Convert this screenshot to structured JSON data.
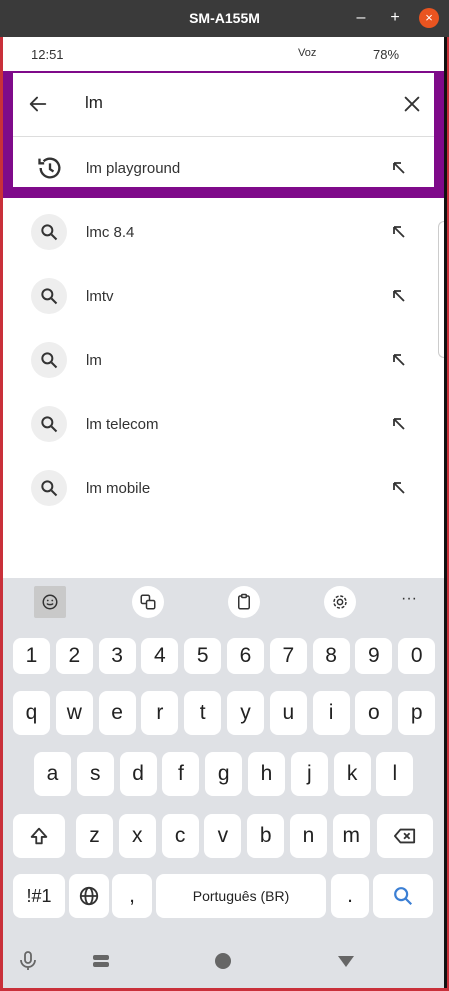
{
  "window": {
    "title": "SM-A155M",
    "minimize": "–",
    "maximize": "+",
    "close": "×"
  },
  "status": {
    "time": "12:51",
    "icons": "Voz",
    "battery": "78%"
  },
  "search": {
    "query": "lm"
  },
  "suggestions": [
    {
      "text": "lm playground",
      "kind": "history-icon"
    },
    {
      "text": "lmc 8.4",
      "kind": "search-icon"
    },
    {
      "text": "lmtv",
      "kind": "search-icon"
    },
    {
      "text": "lm",
      "kind": "search-icon"
    },
    {
      "text": "lm telecom",
      "kind": "search-icon"
    },
    {
      "text": "lm mobile",
      "kind": "search-icon"
    }
  ],
  "keyboard": {
    "toolbar": [
      "emoji-icon",
      "translate-icon",
      "clipboard-icon",
      "settings-icon",
      "more-icon"
    ],
    "more_label": "···",
    "row_numbers": [
      "1",
      "2",
      "3",
      "4",
      "5",
      "6",
      "7",
      "8",
      "9",
      "0"
    ],
    "row1": [
      "q",
      "w",
      "e",
      "r",
      "t",
      "y",
      "u",
      "i",
      "o",
      "p"
    ],
    "row2": [
      "a",
      "s",
      "d",
      "f",
      "g",
      "h",
      "j",
      "k",
      "l"
    ],
    "row3": [
      "z",
      "x",
      "c",
      "v",
      "b",
      "n",
      "m"
    ],
    "symbols_label": "!#1",
    "comma": ",",
    "space_label": "Português (BR)",
    "period": "."
  },
  "colors": {
    "highlight": "#7f0a8a",
    "keyboard_bg": "#dfe1e5",
    "search_key": "#3b7fd4"
  }
}
